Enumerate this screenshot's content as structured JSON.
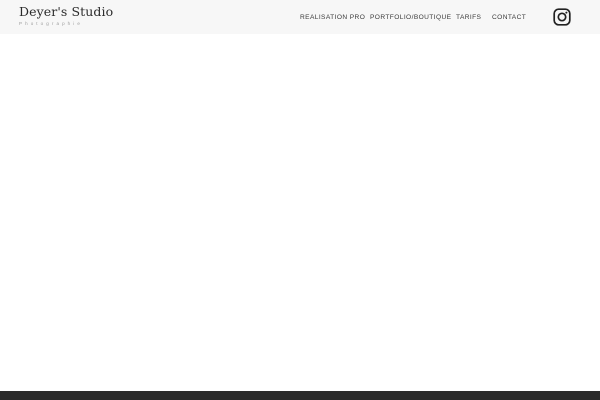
{
  "header": {
    "logo_title": "Deyer's Studio",
    "logo_subtitle": "Photographie"
  },
  "nav": {
    "items": [
      {
        "label": "REALISATION PRO"
      },
      {
        "label": "PORTFOLIO/BOUTIQUE"
      },
      {
        "label": "TARIFS"
      },
      {
        "label": "CONTACT"
      }
    ]
  },
  "icons": {
    "social": "instagram-icon"
  },
  "colors": {
    "header_background": "#f7f7f7",
    "page_background": "#ffffff",
    "footer_bar": "#2b2b2b",
    "text": "#3a3a3a"
  }
}
